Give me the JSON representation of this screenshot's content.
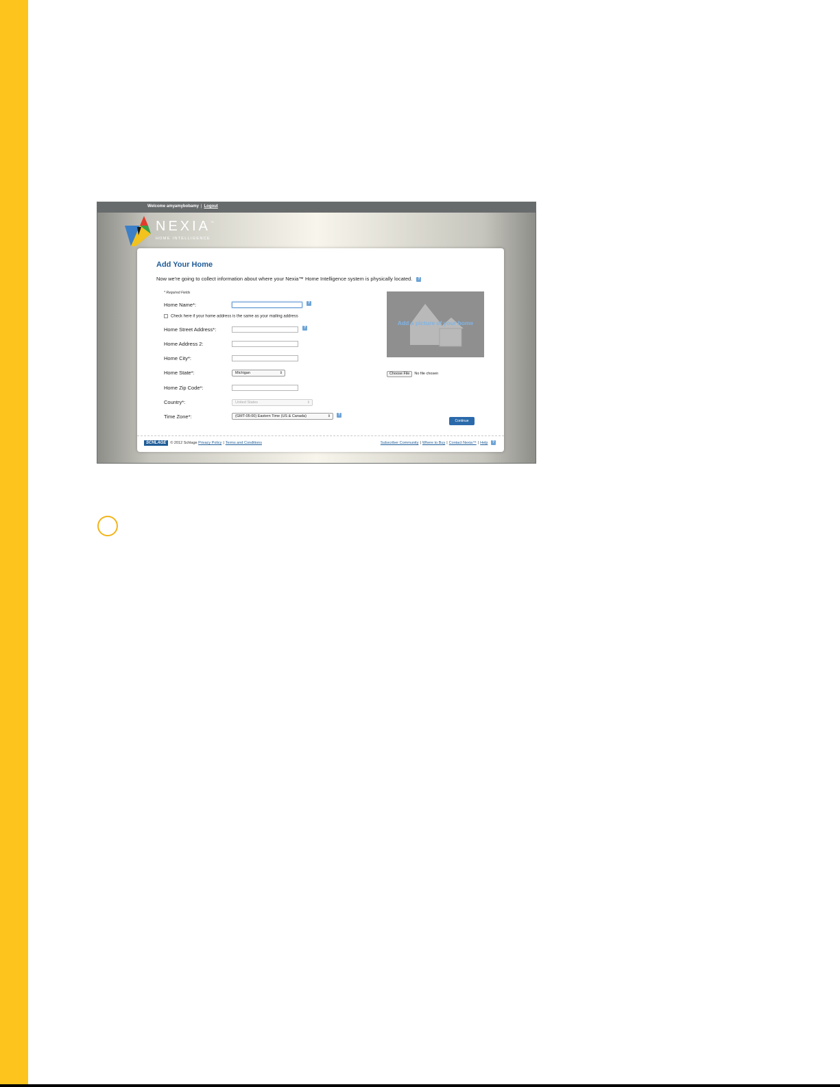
{
  "colors": {
    "sidebar": "#fcc41c",
    "brand_blue": "#1f5c97",
    "help_blue": "#6ea4d6"
  },
  "topbar": {
    "welcome": "Welcome amyamybobamy",
    "separator": "|",
    "logout": "Logout"
  },
  "logo": {
    "word": "NEXIA",
    "tm": "™",
    "tagline": "HOME INTELLIGENCE"
  },
  "page": {
    "title": "Add Your Home",
    "intro": "Now we're going to collect information about where your Nexia™ Home Intelligence system is physically located.",
    "required_note": "* Required Fields"
  },
  "form": {
    "home_name_label": "Home Name*:",
    "same_address_label": "Check here if your home address is the same as your mailing address",
    "street_label": "Home Street Address*:",
    "address2_label": "Home Address 2:",
    "city_label": "Home City*:",
    "state_label": "Home State*:",
    "state_value": "Michigan",
    "zip_label": "Home Zip Code*:",
    "country_label": "Country*:",
    "country_value": "United States",
    "timezone_label": "Time Zone*:",
    "timezone_value": "(GMT-05:00) Eastern Time (US & Canada)"
  },
  "photo": {
    "text": "Add a picture of your home",
    "choose_button": "Choose File",
    "no_file": "No file chosen"
  },
  "continue_button": "Continue",
  "footer": {
    "brand": "SCHLAGE",
    "copyright": "© 2012 Schlage",
    "privacy": "Privacy Policy",
    "terms": "Terms and Conditions",
    "community": "Subscriber Community",
    "where_to_buy": "Where to Buy",
    "contact": "Contact Nexia™",
    "help": "Help",
    "separator": "|"
  },
  "icons": {
    "help": "help-icon",
    "select_arrow": "updown-arrow-icon"
  }
}
